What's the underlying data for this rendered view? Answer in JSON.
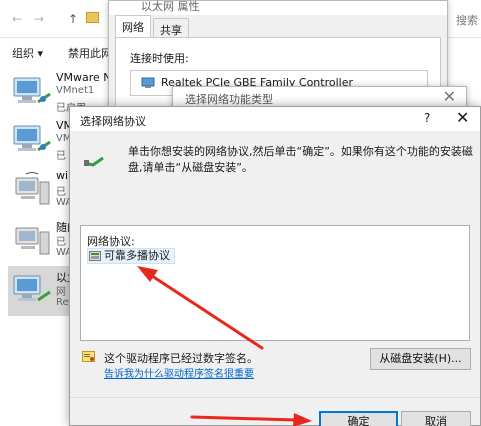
{
  "explorer": {
    "nav": {
      "back": "←",
      "forward": "→",
      "up": "↑"
    },
    "search_text": "搜索",
    "cmd": {
      "organize": "组织 ▾",
      "disable": "禁用此网"
    },
    "items": [
      {
        "name": "VMware Ne",
        "sub1": "VMnet1",
        "sub2": "已启用"
      },
      {
        "name": "VM",
        "sub1": "VM",
        "sub2": "已"
      },
      {
        "name": "win",
        "sub1": "已",
        "sub2": "WA"
      },
      {
        "name": "随的",
        "sub1": "已",
        "sub2": "WA"
      },
      {
        "name": "以太",
        "sub1": "网",
        "sub2": "Re"
      }
    ]
  },
  "properties_dialog": {
    "title": "以太网 属性",
    "tabs": [
      {
        "label": "网络"
      },
      {
        "label": "共享"
      }
    ],
    "connect_using_label": "连接时使用:",
    "adapter_name": "Realtek PCIe GBE Family Controller"
  },
  "feature_dialog": {
    "title": "选择网络功能类型",
    "close": "✕"
  },
  "protocol_dialog": {
    "title": "选择网络协议",
    "help": "?",
    "close": "✕",
    "description": "单击你想安装的网络协议,然后单击“确定”。如果你有这个功能的安装磁盘,请单击“从磁盘安装”。",
    "list_header": "网络协议:",
    "list_items": [
      {
        "label": "可靠多播协议"
      }
    ],
    "signed_text": "这个驱动程序已经过数字签名。",
    "signing_link": "告诉我为什么驱动程序签名很重要",
    "have_disk_button": "从磁盘安装(H)...",
    "ok_button": "确定",
    "cancel_button": "取消"
  },
  "colors": {
    "accent_blue": "#0078d7",
    "link_blue": "#0066cc",
    "annotation_red": "#e8281e",
    "dialog_bg": "#f0f0f0"
  }
}
